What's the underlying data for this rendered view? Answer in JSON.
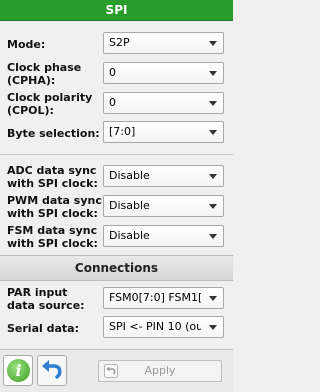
{
  "header": {
    "title": "SPI"
  },
  "fields": {
    "mode": {
      "label": "Mode:",
      "value": "S2P"
    },
    "cpha": {
      "label_line1": "Clock phase",
      "label_line2": "(CPHA):",
      "value": "0"
    },
    "cpol": {
      "label_line1": "Clock polarity",
      "label_line2": "(CPOL):",
      "value": "0"
    },
    "byte_selection": {
      "label": "Byte selection:",
      "value": "[7:0]"
    },
    "adc_sync": {
      "label_line1": "ADC data sync",
      "label_line2": "with SPI clock:",
      "value": "Disable"
    },
    "pwm_sync": {
      "label_line1": "PWM data sync",
      "label_line2": "with SPI clock:",
      "value": "Disable"
    },
    "fsm_sync": {
      "label_line1": "FSM data sync",
      "label_line2": "with SPI clock:",
      "value": "Disable"
    }
  },
  "connections": {
    "title": "Connections",
    "par_input": {
      "label_line1": "PAR input",
      "label_line2": "data source:",
      "value": "FSM0[7:0] FSM1[7:"
    },
    "serial_data": {
      "label": "Serial data:",
      "value": "SPI <- PIN 10 (out)"
    }
  },
  "toolbar": {
    "apply_label": "Apply",
    "info_icon": "info-icon",
    "undo_icon": "undo-icon"
  },
  "colors": {
    "header_bg": "#279c2b",
    "header_text": "#ffffff"
  }
}
